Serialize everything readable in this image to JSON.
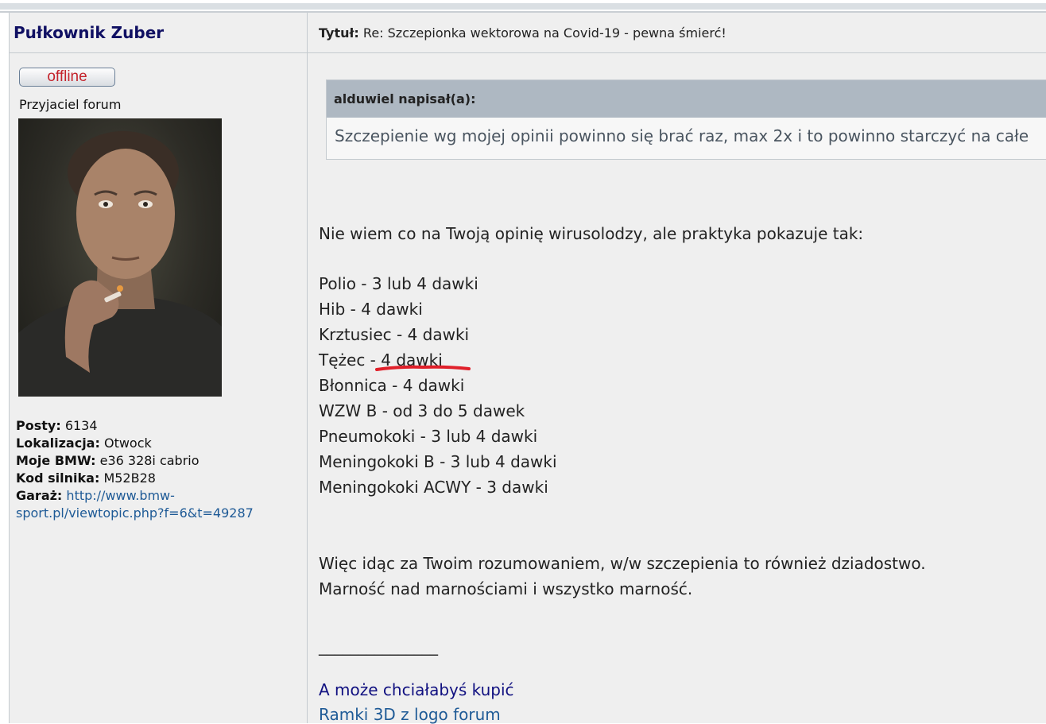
{
  "post": {
    "author": "Pułkownik Zuber",
    "title_label": "Tytuł:",
    "title": "Re: Szczepionka wektorowa na Covid-19 - pewna śmierć!",
    "status": "offline",
    "rank": "Przyjaciel forum",
    "profile": {
      "posts_label": "Posty:",
      "posts": "6134",
      "location_label": "Lokalizacja:",
      "location": "Otwock",
      "bmw_label": "Moje BMW:",
      "bmw": "e36 328i cabrio",
      "engine_label": "Kod silnika:",
      "engine": "M52B28",
      "garage_label": "Garaż:",
      "garage_line1": "http://www.bmw-",
      "garage_line2": "sport.pl/viewtopic.php?f=6&t=49287"
    },
    "quote": {
      "header": "alduwiel napisał(a):",
      "text": "Szczepienie wg mojej opinii powinno się brać raz, max 2x i to powinno starczyć na całe"
    },
    "body": {
      "intro": "Nie wiem co na Twoją opinię wirusolodzy, ale praktyka pokazuje tak:",
      "list": [
        "Polio - 3 lub 4 dawki",
        "Hib - 4 dawki",
        "Krztusiec - 4 dawki",
        "Tężec - 4 dawki",
        "Błonnica - 4 dawki",
        "WZW B - od 3 do 5 dawek",
        "Pneumokoki - 3 lub 4 dawki",
        "Meningokoki B - 3 lub 4 dawki",
        "Meningokoki ACWY - 3 dawki"
      ],
      "conclusion1": "Więc idąc za Twoim rozumowaniem, w/w szczepienia to również dziadostwo.",
      "conclusion2": "Marność nad marnościami i wszystko marność."
    },
    "signature": {
      "rule": "_______________",
      "line1": "A może chciałabyś kupić",
      "line2": "Ramki 3D z logo forum"
    }
  },
  "colors": {
    "author": "#101063",
    "link": "#1e5a96",
    "signature_line1": "#101080",
    "underline_mark": "#e0202a"
  }
}
